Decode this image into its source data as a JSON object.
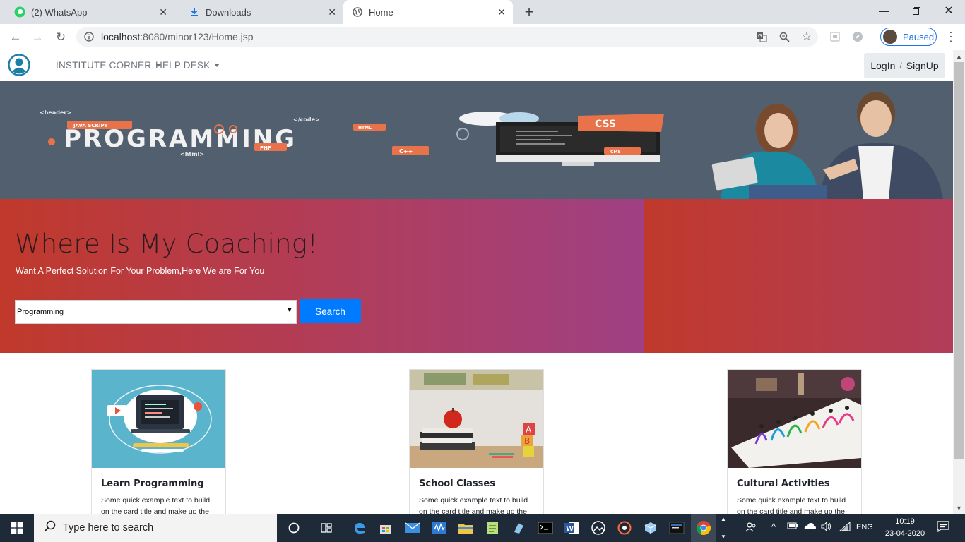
{
  "browser": {
    "tabs": [
      {
        "title": "(2) WhatsApp",
        "icon": "whatsapp-icon",
        "active": false
      },
      {
        "title": "Downloads",
        "icon": "download-icon",
        "active": false
      },
      {
        "title": "Home",
        "icon": "globe-icon",
        "active": true
      }
    ],
    "url_host": "localhost",
    "url_path": ":8080/minor123/Home.jsp",
    "profile_status": "Paused"
  },
  "navbar": {
    "menu": [
      {
        "label": "INSTITUTE CORNER"
      },
      {
        "label": "HELP DESK"
      }
    ],
    "login_label": "LogIn",
    "slash": "/",
    "signup_label": "SignUp"
  },
  "banner": {
    "slide_count": 3,
    "active_slide": 2,
    "words": {
      "main": "PROGRAMMING",
      "java": "JAVA SCRIPT",
      "header": "<header>",
      "code": "</code>",
      "html_tag": "<html>",
      "html": "HTML",
      "php": "PHP",
      "cpp": "C++",
      "css": "CSS",
      "cms": "CMS"
    }
  },
  "hero": {
    "title": "Where Is My Coaching!",
    "subtitle": "Want A Perfect Solution For Your Problem,Here We are For You",
    "select_value": "Programming",
    "search_label": "Search"
  },
  "cards": [
    {
      "title": "Learn Programming",
      "text": "Some quick example text to build on the card title and make up the"
    },
    {
      "title": "School Classes",
      "text": "Some quick example text to build on the card title and make up the"
    },
    {
      "title": "Cultural Activities",
      "text": "Some quick example text to build on the card title and make up the"
    }
  ],
  "taskbar": {
    "search_placeholder": "Type here to search",
    "language": "ENG",
    "time": "10:19",
    "date": "23-04-2020"
  },
  "colors": {
    "accent": "#007bff",
    "hero_start": "#c0392b",
    "hero_end": "#8e44ad",
    "banner_bg": "#525f6e"
  }
}
